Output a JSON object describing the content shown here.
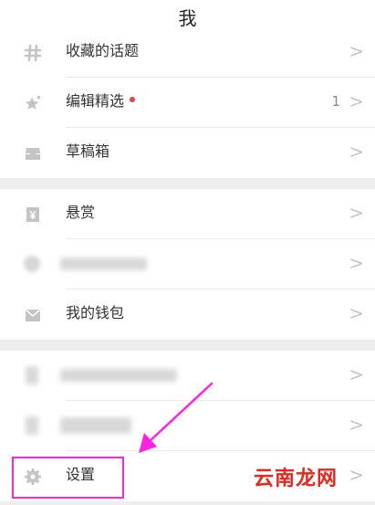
{
  "header": {
    "title": "我"
  },
  "rows": [
    {
      "label": "收藏的话题",
      "icon": "hash-icon"
    },
    {
      "label": "编辑精选",
      "icon": "star-sparkle-icon",
      "count": "1",
      "badge_color": "#e64340"
    },
    {
      "label": "草稿箱",
      "icon": "inbox-tray-icon"
    },
    {
      "label": "悬赏",
      "icon": "yen-icon"
    },
    {
      "label": "",
      "icon": "blurred-icon"
    },
    {
      "label": "我的钱包",
      "icon": "wallet-envelope-icon"
    },
    {
      "label": "",
      "icon": "blurred-icon"
    },
    {
      "label": "",
      "icon": "blurred-icon"
    },
    {
      "label": "设置",
      "icon": "gear-icon"
    }
  ],
  "chevron": ">",
  "annotation": {
    "highlight_color": "#ff22e0"
  },
  "watermark": {
    "text": "云南龙网",
    "color": "#e8261c"
  }
}
